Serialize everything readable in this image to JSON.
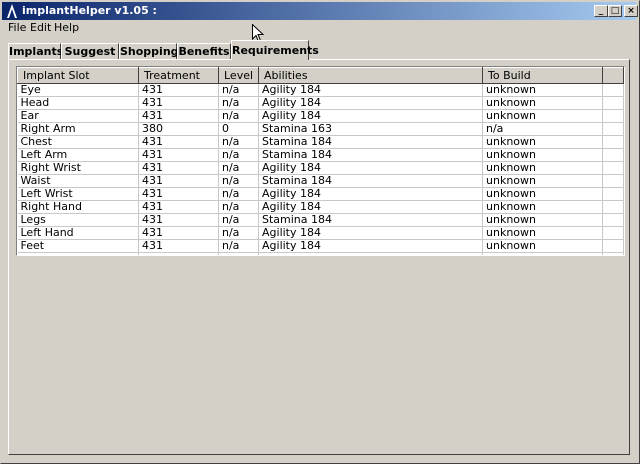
{
  "window": {
    "title": "implantHelper v1.05 :",
    "controls": {
      "minimize": "_",
      "maximize": "□",
      "close": "×"
    }
  },
  "menu": {
    "items": [
      "File",
      "Edit",
      "Help"
    ]
  },
  "tabs": [
    "Implants",
    "Suggest",
    "Shopping",
    "Benefits",
    "Requirements"
  ],
  "active_tab": "Requirements",
  "table": {
    "headers": [
      "Implant Slot",
      "Treatment",
      "Level",
      "Abilities",
      "To Build",
      ""
    ],
    "rows": [
      [
        "Eye",
        "431",
        "n/a",
        "Agility 184",
        "unknown",
        ""
      ],
      [
        "Head",
        "431",
        "n/a",
        "Agility 184",
        "unknown",
        ""
      ],
      [
        "Ear",
        "431",
        "n/a",
        "Agility 184",
        "unknown",
        ""
      ],
      [
        "Right Arm",
        "380",
        "0",
        "Stamina 163",
        "n/a",
        ""
      ],
      [
        "Chest",
        "431",
        "n/a",
        "Stamina 184",
        "unknown",
        ""
      ],
      [
        "Left Arm",
        "431",
        "n/a",
        "Stamina 184",
        "unknown",
        ""
      ],
      [
        "Right Wrist",
        "431",
        "n/a",
        "Agility 184",
        "unknown",
        ""
      ],
      [
        "Waist",
        "431",
        "n/a",
        "Stamina 184",
        "unknown",
        ""
      ],
      [
        "Left Wrist",
        "431",
        "n/a",
        "Agility 184",
        "unknown",
        ""
      ],
      [
        "Right Hand",
        "431",
        "n/a",
        "Agility 184",
        "unknown",
        ""
      ],
      [
        "Legs",
        "431",
        "n/a",
        "Stamina 184",
        "unknown",
        ""
      ],
      [
        "Left Hand",
        "431",
        "n/a",
        "Agility 184",
        "unknown",
        ""
      ],
      [
        "Feet",
        "431",
        "n/a",
        "Agility 184",
        "unknown",
        ""
      ],
      [
        "",
        "",
        "",
        "",
        "",
        ""
      ]
    ]
  }
}
